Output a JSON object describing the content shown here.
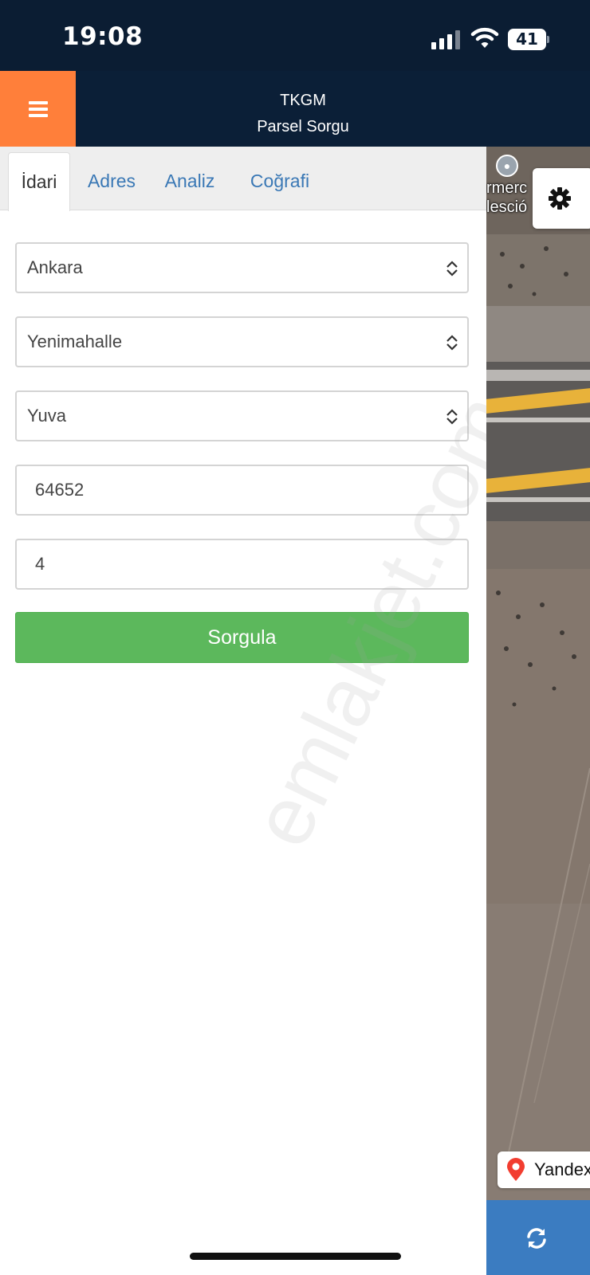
{
  "status_bar": {
    "time": "19:08",
    "battery": "41"
  },
  "header": {
    "title": "TKGM",
    "subtitle": "Parsel Sorgu",
    "menu_icon": "hamburger-menu-icon"
  },
  "tabs": [
    {
      "label": "İdari",
      "active": true
    },
    {
      "label": "Adres",
      "active": false
    },
    {
      "label": "Analiz",
      "active": false
    },
    {
      "label": "Coğrafi",
      "active": false
    }
  ],
  "form": {
    "province": "Ankara",
    "district": "Yenimahalle",
    "neighborhood": "Yuva",
    "block_no": "64652",
    "parcel_no": "4",
    "submit_label": "Sorgula"
  },
  "map": {
    "poi_label": [
      "rmerc",
      "lesció"
    ],
    "poi_icon": "mosque-icon",
    "attribution": "Yandex",
    "settings_icon": "gear-icon",
    "refresh_icon": "refresh-icon"
  },
  "watermark": "emlakjet.com",
  "colors": {
    "header_bg": "#0b1f37",
    "menu_accent": "#ff7f3a",
    "submit_green": "#5cb85c",
    "tab_link": "#3a78b5",
    "refresh_blue": "#3b7cc1"
  }
}
